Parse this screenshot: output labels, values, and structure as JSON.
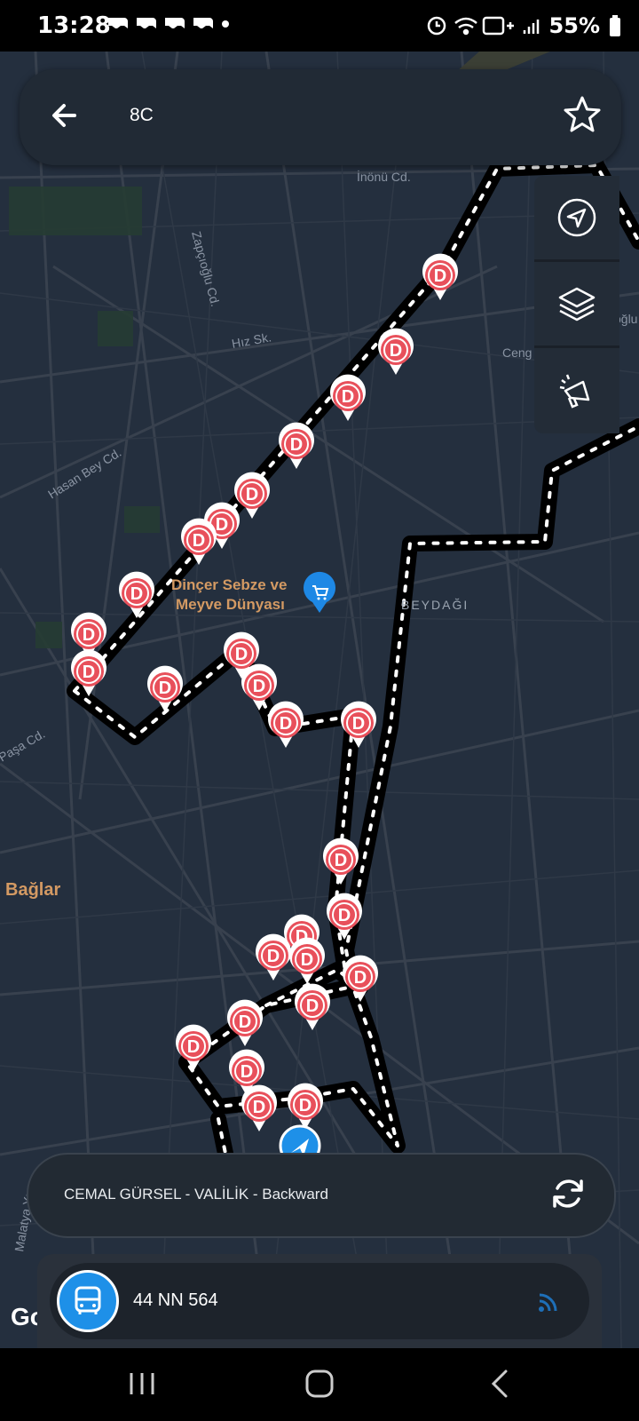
{
  "status": {
    "time": "13:28",
    "battery": "55%"
  },
  "search": {
    "route": "8C"
  },
  "map": {
    "labels": [
      {
        "id": "inonu",
        "text": "İnönü Cd."
      },
      {
        "id": "zapcioglu",
        "text": "Zapçıoğlu Cd."
      },
      {
        "id": "hiz",
        "text": "Hız Sk."
      },
      {
        "id": "hasanbey",
        "text": "Hasan Bey Cd."
      },
      {
        "id": "ceng",
        "text": "Ceng"
      },
      {
        "id": "beydagi",
        "text": "BEYDAĞI"
      },
      {
        "id": "baglar",
        "text": "Bağlar"
      },
      {
        "id": "pasacd",
        "text": "Paşa Cd."
      },
      {
        "id": "malatya",
        "text": "Malatya Yo"
      },
      {
        "id": "ogl",
        "text": "oğlu"
      }
    ],
    "poi": {
      "line1": "Dinçer Sebze ve",
      "line2": "Meyve Dünyası"
    },
    "stop_marker_letter": "D"
  },
  "route_bar": {
    "label": "CEMAL GÜRSEL - VALİLİK  - Backward"
  },
  "vehicle": {
    "plate": "44 NN 564"
  },
  "google": "Go",
  "colors": {
    "accent": "#1e90e8",
    "stop": "#e8505b",
    "map_bg": "#242f3e"
  }
}
